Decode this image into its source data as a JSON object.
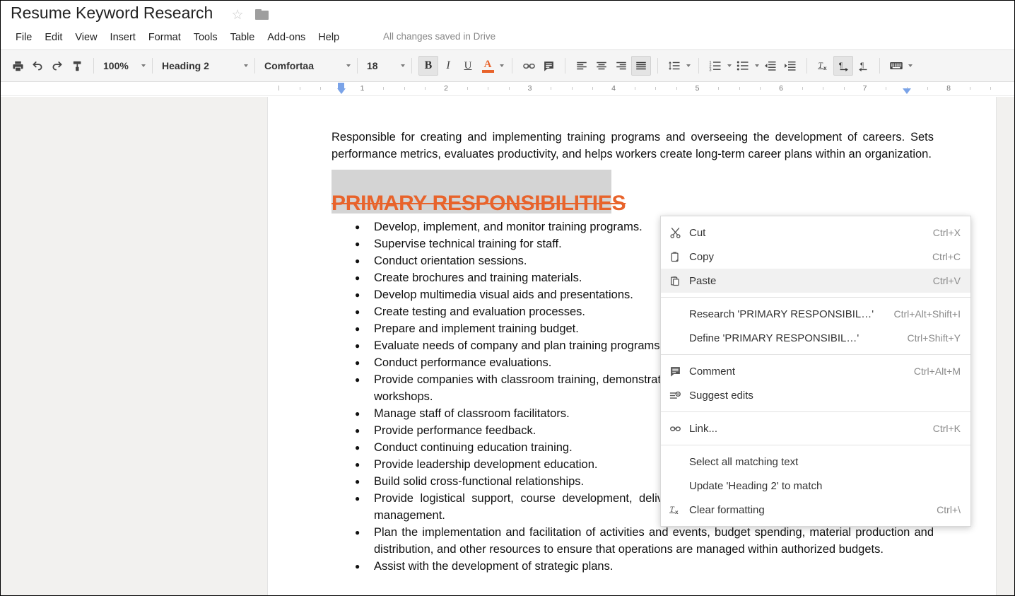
{
  "titlebar": {
    "doc_title": "Resume Keyword Research",
    "star_glyph": "☆",
    "save_status": "All changes saved in Drive"
  },
  "menubar": {
    "items": [
      {
        "label": "File"
      },
      {
        "label": "Edit"
      },
      {
        "label": "View"
      },
      {
        "label": "Insert"
      },
      {
        "label": "Format"
      },
      {
        "label": "Tools"
      },
      {
        "label": "Table"
      },
      {
        "label": "Add-ons"
      },
      {
        "label": "Help"
      }
    ]
  },
  "toolbar": {
    "zoom": "100%",
    "paragraph_style": "Heading 2",
    "font_family": "Comfortaa",
    "font_size": "18",
    "bold_label": "B",
    "italic_label": "I",
    "underline_label": "U",
    "text_color_glyph": "A",
    "text_color_hex": "#E8632B",
    "active_buttons": [
      "bold",
      "justify",
      "ltr"
    ]
  },
  "ruler": {
    "numbers": [
      "1",
      "2",
      "3",
      "4",
      "5",
      "6",
      "7",
      "8"
    ],
    "left_indent_inches": 0.75,
    "right_indent_inches": 7.5,
    "marker_color": "#7aa3e8"
  },
  "document": {
    "intro_paragraph": "Responsible for creating and implementing training programs and overseeing the development of careers. Sets performance metrics, evaluates productivity, and helps workers create long-term career plans within an organization.",
    "heading": "PRIMARY RESPONSIBILITIES",
    "heading_color": "#E8632B",
    "heading_selected": true,
    "selection_color": "#d4d4d4",
    "bullets": [
      "Develop, implement, and monitor training programs.",
      "Supervise technical training for staff.",
      "Conduct orientation sessions.",
      "Create brochures and training materials.",
      "Develop multimedia visual aids and presentations.",
      "Create testing and evaluation processes.",
      "Prepare and implement training budget.",
      "Evaluate needs of company and plan training programs.",
      "Conduct performance evaluations.",
      "Provide companies with classroom training, demonstrations, on-the-job training, meetings, conferences, and workshops.",
      "Manage staff of classroom facilitators.",
      "Provide performance feedback.",
      "Conduct continuing education training.",
      "Provide leadership development education.",
      "Build solid cross-functional relationships.",
      "Provide logistical support, course development, delivery, evaluation, process measurements, and cost management.",
      "Plan the implementation and facilitation of activities and events, budget spending, material production and distribution, and other resources to ensure that operations are managed within authorized budgets.",
      "Assist with the development of strategic plans."
    ]
  },
  "context_menu": {
    "groups": [
      {
        "items": [
          {
            "label": "Cut",
            "shortcut": "Ctrl+X",
            "icon": "scissors-icon",
            "highlight": false
          },
          {
            "label": "Copy",
            "shortcut": "Ctrl+C",
            "icon": "copy-icon",
            "highlight": false
          },
          {
            "label": "Paste",
            "shortcut": "Ctrl+V",
            "icon": "paste-icon",
            "highlight": true
          }
        ]
      },
      {
        "items": [
          {
            "label": "Research 'PRIMARY RESPONSIBIL…'",
            "shortcut": "Ctrl+Alt+Shift+I",
            "icon": "",
            "highlight": false
          },
          {
            "label": "Define 'PRIMARY RESPONSIBIL…'",
            "shortcut": "Ctrl+Shift+Y",
            "icon": "",
            "highlight": false
          }
        ]
      },
      {
        "items": [
          {
            "label": "Comment",
            "shortcut": "Ctrl+Alt+M",
            "icon": "comment-icon",
            "highlight": false
          },
          {
            "label": "Suggest edits",
            "shortcut": "",
            "icon": "suggest-edits-icon",
            "highlight": false
          }
        ]
      },
      {
        "items": [
          {
            "label": "Link...",
            "shortcut": "Ctrl+K",
            "icon": "link-icon",
            "highlight": false
          }
        ]
      },
      {
        "items": [
          {
            "label": "Select all matching text",
            "shortcut": "",
            "icon": "",
            "highlight": false
          },
          {
            "label": "Update 'Heading 2' to match",
            "shortcut": "",
            "icon": "",
            "highlight": false
          },
          {
            "label": "Clear formatting",
            "shortcut": "Ctrl+\\",
            "icon": "clear-formatting-icon",
            "highlight": false
          }
        ]
      }
    ]
  }
}
